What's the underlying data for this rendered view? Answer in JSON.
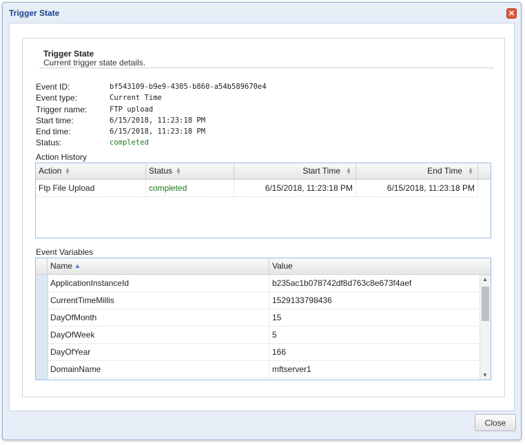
{
  "window": {
    "title": "Trigger State",
    "close_icon": "close-icon"
  },
  "header": {
    "title": "Trigger State",
    "description": "Current trigger state details."
  },
  "info": {
    "event_id_label": "Event ID:",
    "event_id": "bf543109-b9e9-4305-b860-a54b589670e4",
    "event_type_label": "Event type:",
    "event_type": "Current Time",
    "trigger_name_label": "Trigger name:",
    "trigger_name": "FTP upload",
    "start_time_label": "Start time:",
    "start_time": "6/15/2018, 11:23:18 PM",
    "end_time_label": "End time:",
    "end_time": "6/15/2018, 11:23:18 PM",
    "status_label": "Status:",
    "status": "completed",
    "status_color": "#1a7a1a"
  },
  "action_history": {
    "label": "Action History",
    "columns": [
      "Action",
      "Status",
      "Start Time",
      "End Time"
    ],
    "rows": [
      {
        "action": "Ftp File Upload",
        "status": "completed",
        "start": "6/15/2018, 11:23:18 PM",
        "end": "6/15/2018, 11:23:18 PM"
      }
    ]
  },
  "event_variables": {
    "label": "Event Variables",
    "columns": [
      "Name",
      "Value"
    ],
    "sort": "Name ascending",
    "rows": [
      {
        "name": "ApplicationInstanceId",
        "value": "b235ac1b078742df8d763c8e673f4aef"
      },
      {
        "name": "CurrentTimeMillis",
        "value": "1529133798436"
      },
      {
        "name": "DayOfMonth",
        "value": "15"
      },
      {
        "name": "DayOfWeek",
        "value": "5"
      },
      {
        "name": "DayOfYear",
        "value": "166"
      },
      {
        "name": "DomainName",
        "value": "mftserver1"
      }
    ]
  },
  "footer": {
    "close_label": "Close"
  }
}
